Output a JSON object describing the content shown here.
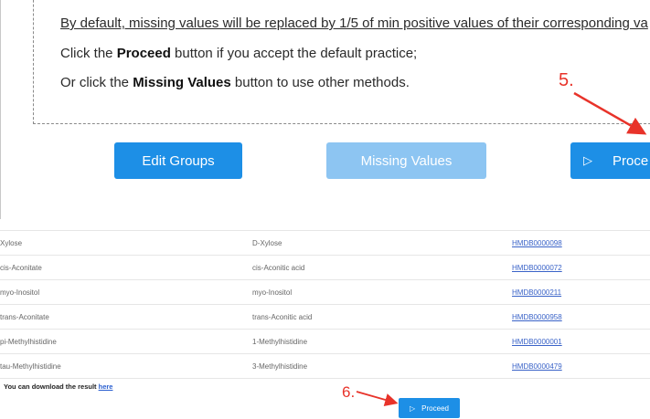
{
  "notice": {
    "line_default": "By default, missing values will be replaced by 1/5 of min positive values of their corresponding va",
    "line_proceed_prefix": "Click the ",
    "line_proceed_bold": "Proceed",
    "line_proceed_suffix": " button if you accept the default practice;",
    "line_missing_prefix": "Or click the ",
    "line_missing_bold": "Missing Values",
    "line_missing_suffix": " button to use other methods."
  },
  "buttons": {
    "edit_groups": "Edit Groups",
    "missing_values": "Missing Values",
    "proceed": "Proce"
  },
  "annotations": {
    "step5": "5.",
    "step6": "6."
  },
  "table": {
    "rows": [
      {
        "name": "Xylose",
        "match": "D-Xylose",
        "hmdb": "HMDB0000098"
      },
      {
        "name": "cis-Aconitate",
        "match": "cis-Aconitic acid",
        "hmdb": "HMDB0000072"
      },
      {
        "name": "myo-Inositol",
        "match": "myo-Inositol",
        "hmdb": "HMDB0000211"
      },
      {
        "name": "trans-Aconitate",
        "match": "trans-Aconitic acid",
        "hmdb": "HMDB0000958"
      },
      {
        "name": "pi-Methylhistidine",
        "match": "1-Methylhistidine",
        "hmdb": "HMDB0000001"
      },
      {
        "name": "tau-Methylhistidine",
        "match": "3-Methylhistidine",
        "hmdb": "HMDB0000479"
      }
    ]
  },
  "download": {
    "text": "You can download the result ",
    "link": "here"
  },
  "bottom_button": {
    "label": "Proceed"
  },
  "colors": {
    "primary": "#1d8fe6",
    "disabled": "#8dc5f2",
    "annotation": "#e8332a",
    "link": "#3a63c8"
  }
}
